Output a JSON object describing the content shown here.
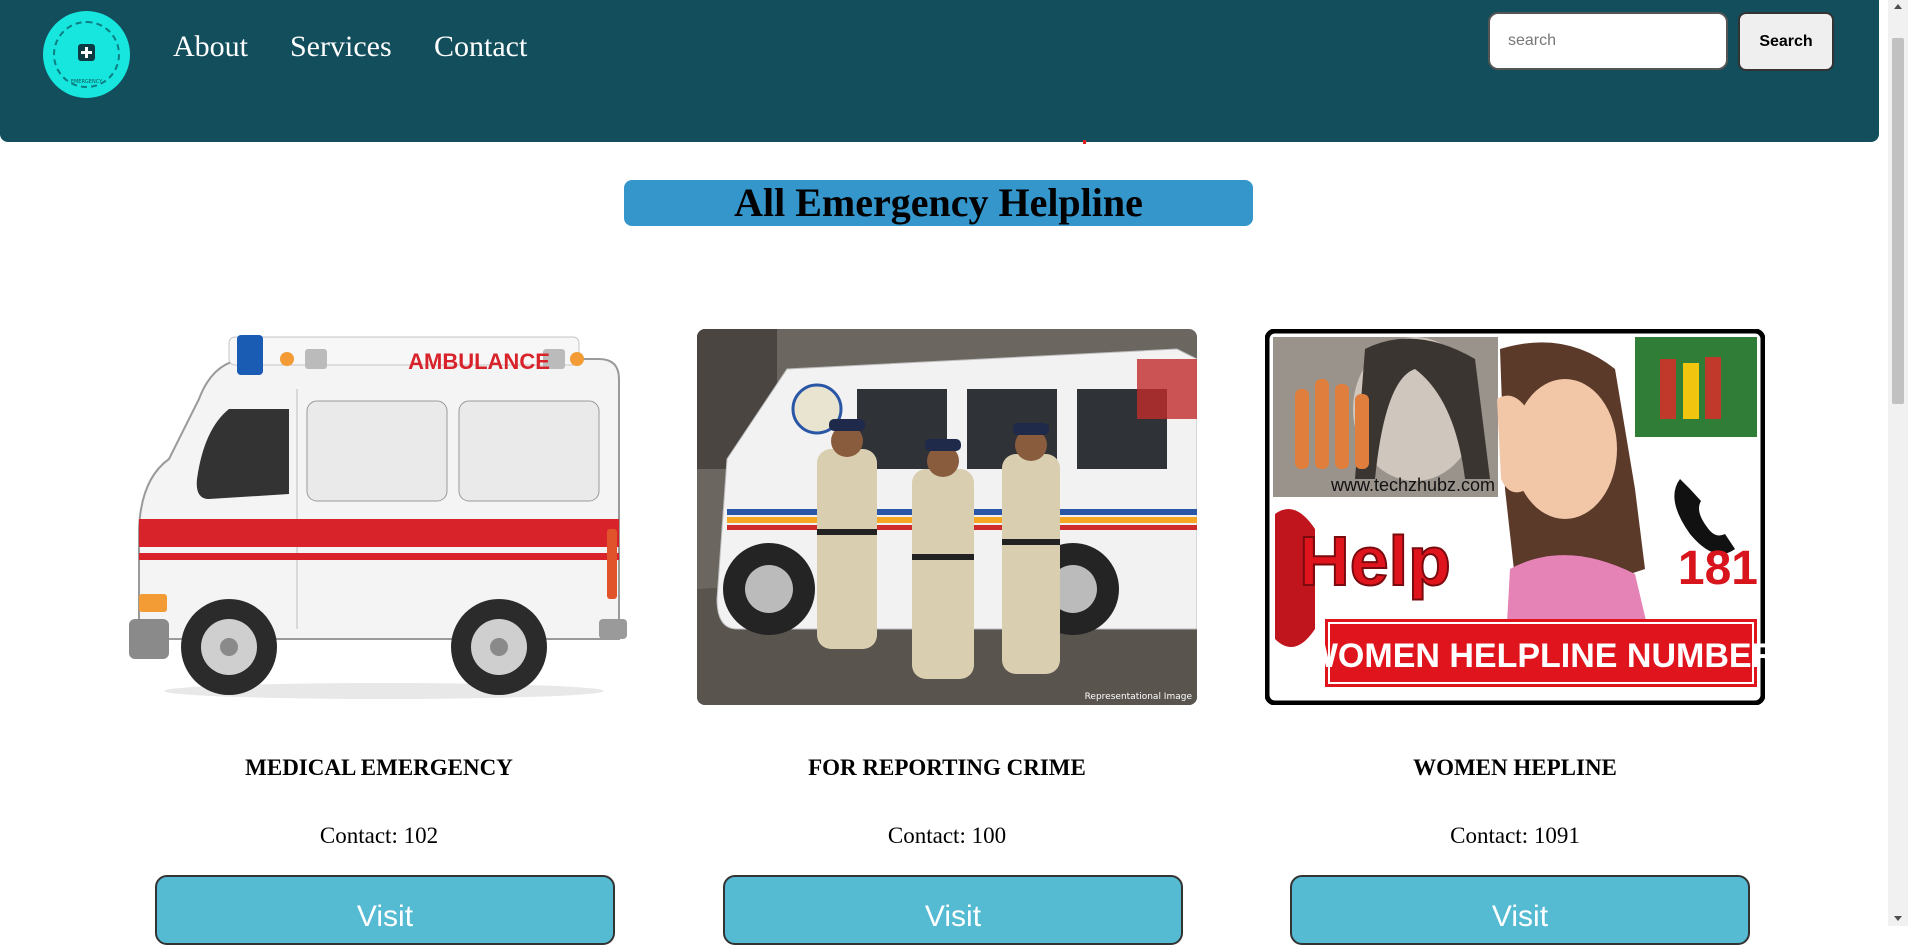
{
  "nav": {
    "logo_text": "EMERGENCY",
    "links": [
      "About",
      "Services",
      "Contact"
    ],
    "search": {
      "placeholder": "search",
      "button_label": "Search"
    }
  },
  "page": {
    "title": "All Emergency Helpline"
  },
  "cards": [
    {
      "title": "MEDICAL EMERGENCY",
      "contact": "Contact: 102",
      "button": "Visit",
      "image": {
        "icon": "ambulance-image",
        "label": "AMBULANCE"
      }
    },
    {
      "title": "FOR REPORTING CRIME",
      "contact": "Contact: 100",
      "button": "Visit",
      "image": {
        "icon": "police-image",
        "caption": "Representational Image"
      }
    },
    {
      "title": "WOMEN HEPLINE",
      "contact": "Contact: 1091",
      "button": "Visit",
      "image": {
        "icon": "women-helpline-image",
        "site": "www.techzhubz.com",
        "help": "Help",
        "number": "181",
        "banner": "WOMEN HELPLINE NUMBER"
      }
    }
  ],
  "colors": {
    "navbar": "#124e5c",
    "logo": "#17e6df",
    "title_bg": "#3596cc",
    "button": "#55bbd3"
  }
}
